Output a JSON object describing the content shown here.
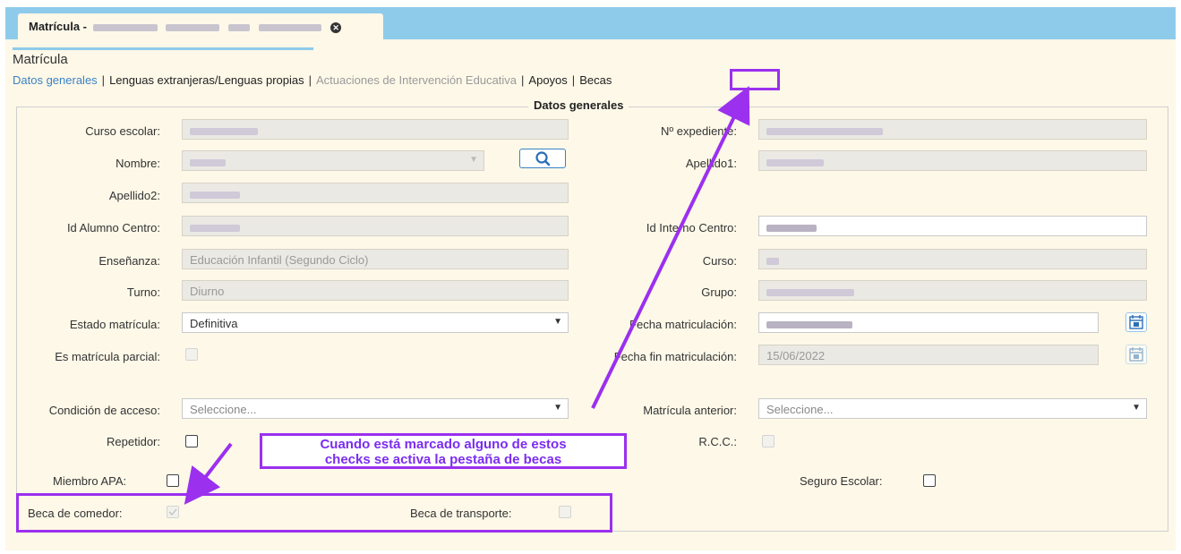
{
  "window": {
    "tab_title": "Matrícula -",
    "tab_title_redacted": true
  },
  "page": {
    "title": "Matrícula"
  },
  "nav": {
    "items": [
      {
        "label": "Datos generales",
        "state": "active"
      },
      {
        "label": "Lenguas extranjeras/Lenguas propias",
        "state": "normal"
      },
      {
        "label": "Actuaciones de Intervención Educativa",
        "state": "disabled"
      },
      {
        "label": "Apoyos",
        "state": "normal"
      },
      {
        "label": "Becas",
        "state": "normal"
      }
    ],
    "separator": "|"
  },
  "section": {
    "legend": "Datos generales"
  },
  "form": {
    "curso_escolar": {
      "label": "Curso escolar:",
      "value": ""
    },
    "nro_expediente": {
      "label": "Nº expediente:",
      "value": ""
    },
    "nombre": {
      "label": "Nombre:",
      "value": ""
    },
    "apellido1": {
      "label": "Apellido1:",
      "value": ""
    },
    "apellido2": {
      "label": "Apellido2:",
      "value": ""
    },
    "id_alumno_centro": {
      "label": "Id Alumno Centro:",
      "value": ""
    },
    "id_interno_centro": {
      "label": "Id Interno Centro:",
      "value": ""
    },
    "ensenanza": {
      "label": "Enseñanza:",
      "value": "Educación Infantil (Segundo Ciclo)"
    },
    "curso": {
      "label": "Curso:",
      "value": ""
    },
    "turno": {
      "label": "Turno:",
      "value": "Diurno"
    },
    "grupo": {
      "label": "Grupo:",
      "value": ""
    },
    "estado_matricula": {
      "label": "Estado matrícula:",
      "value": "Definitiva"
    },
    "fecha_matriculacion": {
      "label": "Fecha matriculación:",
      "value": ""
    },
    "es_matricula_parcial": {
      "label": "Es matrícula parcial:",
      "checked": false
    },
    "fecha_fin_matriculacion": {
      "label": "Fecha fin matriculación:",
      "value": "15/06/2022"
    },
    "condicion_acceso": {
      "label": "Condición de acceso:",
      "placeholder": "Seleccione..."
    },
    "matricula_anterior": {
      "label": "Matrícula anterior:",
      "placeholder": "Seleccione..."
    },
    "repetidor": {
      "label": "Repetidor:",
      "checked": false
    },
    "rcc": {
      "label": "R.C.C.:",
      "checked": false
    },
    "miembro_apa": {
      "label": "Miembro APA:",
      "checked": false
    },
    "seguro_escolar": {
      "label": "Seguro Escolar:",
      "checked": false
    },
    "beca_comedor": {
      "label": "Beca de comedor:",
      "checked": true
    },
    "beca_transporte": {
      "label": "Beca de transporte:",
      "checked": false
    }
  },
  "annotation": {
    "callout_line1": "Cuando está marcado alguno de estos",
    "callout_line2": "checks se activa la pestaña de becas",
    "color": "#9b30ef"
  },
  "colors": {
    "header_bar": "#8ecbea",
    "panel_bg": "#fdf8e8",
    "link_active": "#3b82c4",
    "disabled_input": "#ebe9e4"
  },
  "icons": {
    "search": "search-icon",
    "calendar": "calendar-icon",
    "close_tab": "close-icon",
    "dropdown": "chevron-down-icon"
  }
}
